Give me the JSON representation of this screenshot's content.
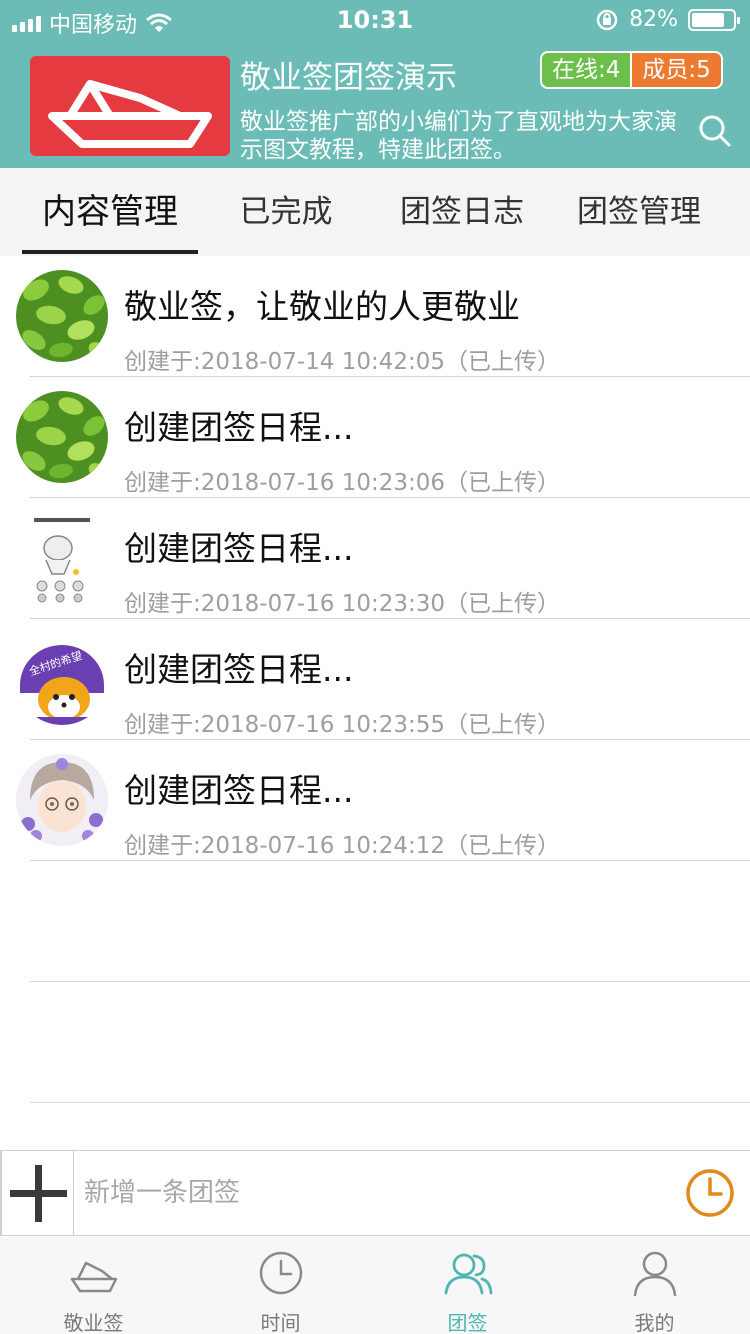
{
  "status_bar": {
    "carrier": "中国移动",
    "time": "10:31",
    "battery": "82%",
    "battery_level": 0.82
  },
  "group": {
    "title": "敬业签团签演示",
    "description": "敬业签推广部的小编们为了直观地为大家演示图文教程，特建此团签。",
    "online_label": "在线:4",
    "members_label": "成员:5"
  },
  "tabs": [
    {
      "label": "内容管理",
      "active": true
    },
    {
      "label": "已完成",
      "active": false
    },
    {
      "label": "团签日志",
      "active": false
    },
    {
      "label": "团签管理",
      "active": false
    }
  ],
  "items": [
    {
      "title": "敬业签，让敬业的人更敬业",
      "meta": "创建于:2018-07-14 10:42:05（已上传）",
      "avatar": "leaves-avatar"
    },
    {
      "title": "创建团签日程...",
      "meta": "创建于:2018-07-16 10:23:06（已上传）",
      "avatar": "leaves-avatar"
    },
    {
      "title": "创建团签日程...",
      "meta": "创建于:2018-07-16 10:23:30（已上传）",
      "avatar": "sketch-avatar"
    },
    {
      "title": "创建团签日程...",
      "meta": "创建于:2018-07-16 10:23:55（已上传）",
      "avatar": "shiba-avatar",
      "avatar_text": "全村的希望"
    },
    {
      "title": "创建团签日程...",
      "meta": "创建于:2018-07-16 10:24:12（已上传）",
      "avatar": "anime-boy-avatar"
    }
  ],
  "input": {
    "placeholder": "新增一条团签"
  },
  "bottom_nav": [
    {
      "label": "敬业签",
      "icon": "boat-icon",
      "active": false
    },
    {
      "label": "时间",
      "icon": "clock-icon",
      "active": false
    },
    {
      "label": "团签",
      "icon": "group-icon",
      "active": true
    },
    {
      "label": "我的",
      "icon": "person-icon",
      "active": false
    }
  ],
  "colors": {
    "header_bg": "#6bbcb6",
    "logo_red": "#e53a3f",
    "online_green": "#6cbf4a",
    "members_orange": "#ec7a30",
    "accent_teal": "#4fb7b0",
    "clock_orange": "#e08a1e"
  }
}
